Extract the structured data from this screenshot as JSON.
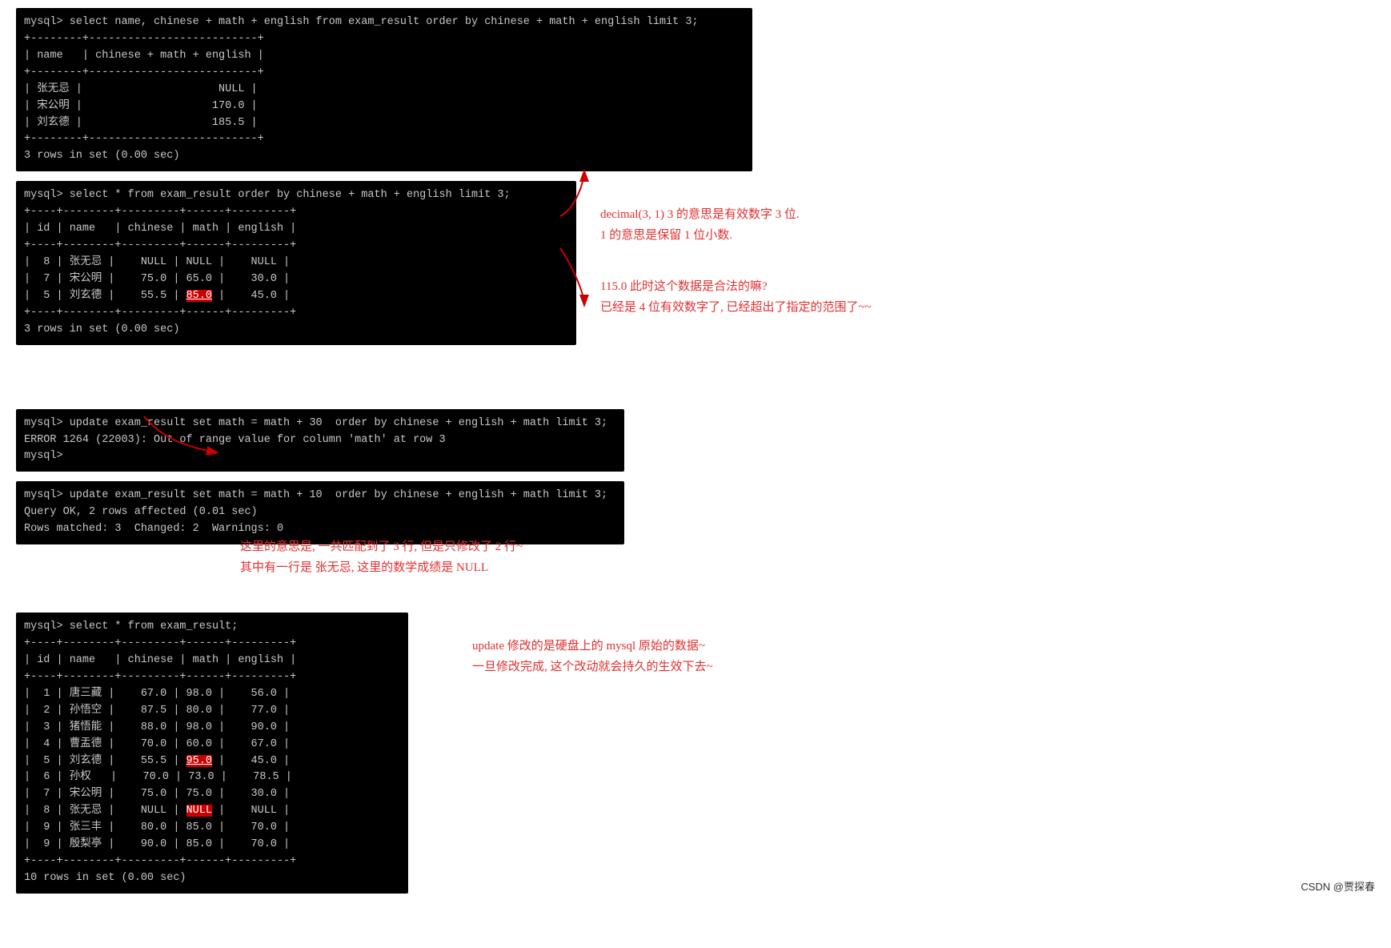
{
  "blocks": {
    "b1": {
      "content": "mysql> select name, chinese + math + english from exam_result order by chinese + math + english limit 3;\n+--------+------------------------+\n| name   | chinese + math + english |\n+--------+------------------------+\n| 张无忌 |                    NULL  |\n| 宋公明 |                   170.0  |\n| 刘玄德 |                   185.5  |\n+--------+------------------------+\n3 rows in set (0.00 sec)"
    },
    "b2": {
      "content": "mysql> select * from exam_result order by chinese + math + english limit 3;\n+----+--------+---------+------+---------+\n| id | name   | chinese | math | english |\n+----+--------+---------+------+---------+\n|  8 | 张无忌 |    NULL | NULL |    NULL |\n|  7 | 宋公明 |    75.0 | 65.0 |    30.0 |\n|  5 | 刘玄德 |    55.5 | 85.0 |    45.0 |\n+----+--------+---------+------+---------+\n3 rows in set (0.00 sec)"
    },
    "b3": {
      "content": "mysql> update exam_result set math = math + 30  order by chinese + english + math limit 3;\nERROR 1264 (22003): Out of range value for column 'math' at row 3\nmysql>"
    },
    "b4": {
      "content": "mysql> update exam_result set math = math + 10  order by chinese + english + math limit 3;\nQuery OK, 2 rows affected (0.01 sec)\nRows matched: 3  Changed: 2  Warnings: 0"
    },
    "b5": {
      "content": "mysql> select * from exam_result;\n+----+--------+---------+------+---------+\n| id | name   | chinese | math | english |\n+----+--------+---------+------+---------+\n|  1 | 唐三藏 |    67.0 | 98.0 |    56.0 |\n|  2 | 孙悟空 |    87.5 | 80.0 |    77.0 |\n|  3 | 猪悟能 |    88.0 | 98.0 |    90.0 |\n|  4 | 曹盂德 |    70.0 | 60.0 |    67.0 |\n|  5 | 刘玄德 |    55.5 | 95.0 |    45.0 |\n|  6 | 孙权   |    70.0 | 73.0 |    78.5 |\n|  7 | 宋公明 |    75.0 | 75.0 |    30.0 |\n|  8 | 张无忌 |    NULL | NULL |    NULL |\n|  9 | 张三丰 |    80.0 | 85.0 |    70.0 |\n|  9 | 殷梨亭 |    90.0 | 85.0 |    70.0 |\n+----+--------+---------+------+---------+\n10 rows in set (0.00 sec)"
    },
    "annotations": {
      "a1_line1": "decimal(3, 1)   3 的意思是有效数字 3 位.",
      "a1_line2": "1 的意思是保留 1 位小数.",
      "a2_line1": "115.0 此时这个数据是合法的嘛?",
      "a2_line2": "已经是 4 位有效数字了, 已经超出了指定的范围了~~",
      "a3_line1": "这里的意思是, 一共匹配到了 3 行, 但是只修改了 2 行~",
      "a3_line2": "其中有一行是 张无忌, 这里的数学成绩是 NULL",
      "a4_line1": "update 修改的是硬盘上的 mysql 原始的数据~",
      "a4_line2": "一旦修改完成, 这个改动就会持久的生效下去~"
    },
    "watermark": "CSDN @贾探春"
  }
}
